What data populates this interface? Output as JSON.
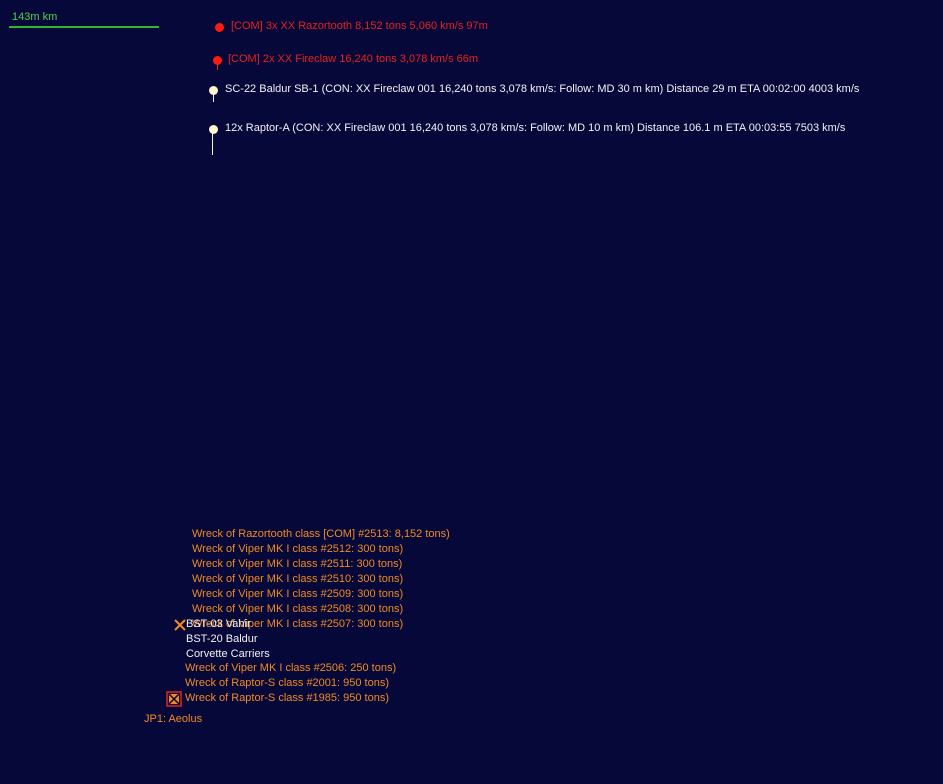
{
  "scale": {
    "label": "143m km"
  },
  "contacts": {
    "c1": {
      "text": "[COM]  3x XX Razortooth  8,152 tons   5,060 km/s  97m"
    },
    "c2": {
      "text": "[COM]  2x XX Fireclaw  16,240 tons   3,078 km/s  66m"
    },
    "c3": {
      "text": "SC-22 Baldur SB-1  (CON: XX Fireclaw 001  16,240 tons   3,078 km/s: Follow: MD 30 m km)   Distance 29 m   ETA 00:02:00   4003 km/s"
    },
    "c4": {
      "text": "12x Raptor-A  (CON: XX Fireclaw 001  16,240 tons   3,078 km/s: Follow: MD 10 m km)   Distance 106.1 m   ETA 00:03:55   7503 km/s"
    }
  },
  "wrecks_upper": [
    "Wreck of Razortooth class [COM] #2513: 8,152 tons)",
    "Wreck of Viper MK I class  #2512: 300 tons)",
    "Wreck of Viper MK I class  #2511: 300 tons)",
    "Wreck of Viper MK I class  #2510: 300 tons)",
    "Wreck of Viper MK I class  #2509: 300 tons)",
    "Wreck of Viper MK I class  #2508: 300 tons)",
    "Wreck of Viper MK I class  #2507: 300 tons)"
  ],
  "own_fleets": {
    "f1": "BST-03 Vahir",
    "f2": "BST-20 Baldur",
    "f3": "Corvette Carriers"
  },
  "wrecks_lower": [
    "Wreck of Viper MK I class  #2506: 250 tons)",
    "Wreck of Raptor-S class  #2001: 950 tons)",
    "Wreck of Raptor-S class  #1985: 950 tons)"
  ],
  "jump_point": {
    "label": "JP1: Aeolus"
  },
  "colors": {
    "background": "#06083a",
    "hostile": "#e8201c",
    "friendly": "#f2f2f2",
    "wreck": "#f08a22",
    "scale": "#4fd14f"
  }
}
